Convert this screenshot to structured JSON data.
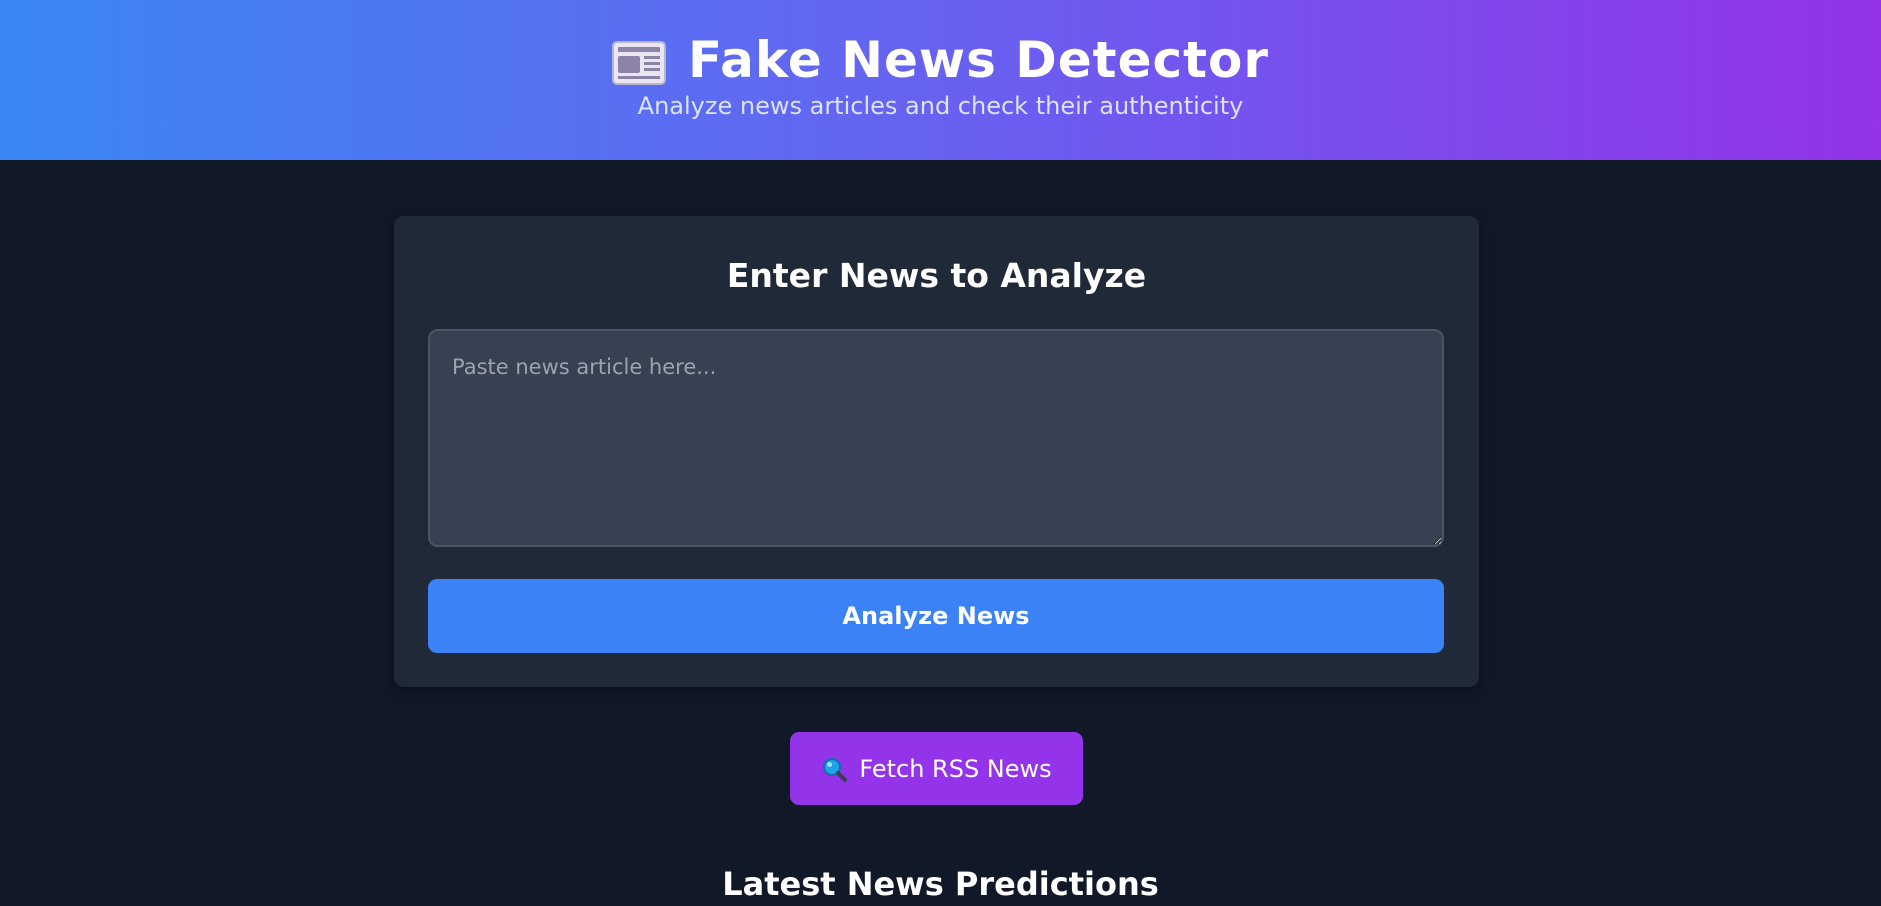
{
  "header": {
    "title": "Fake News Detector",
    "subtitle": "Analyze news articles and check their authenticity",
    "icon": "newspaper-icon"
  },
  "analyze_card": {
    "title": "Enter News to Analyze",
    "textarea": {
      "placeholder": "Paste news article here...",
      "value": ""
    },
    "analyze_button_label": "Analyze News"
  },
  "rss_button": {
    "label": "Fetch RSS News",
    "icon": "magnifier-icon"
  },
  "predictions_section": {
    "title": "Latest News Predictions"
  },
  "colors": {
    "background": "#111827",
    "card": "#1f2937",
    "input": "#374151",
    "primary_blue": "#3b82f6",
    "purple": "#9333ea",
    "header_gradient_start": "#3b87f5",
    "header_gradient_end": "#9333ea"
  }
}
